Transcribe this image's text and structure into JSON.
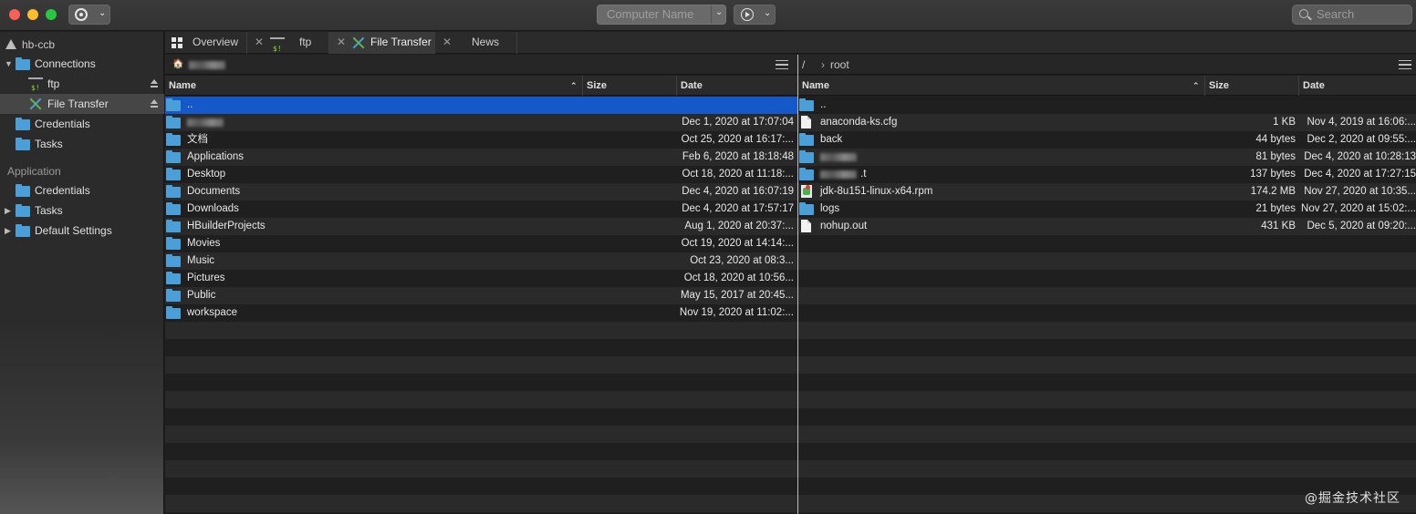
{
  "titlebar": {
    "computer_name_placeholder": "Computer Name",
    "search_placeholder": "Search"
  },
  "sidebar": {
    "account": "hb-ccb",
    "connections_label": "Connections",
    "connections": [
      {
        "label": "ftp",
        "icon": "terminal-icon"
      },
      {
        "label": "File Transfer",
        "icon": "file-transfer-icon"
      }
    ],
    "credentials_label": "Credentials",
    "tasks_label": "Tasks",
    "application_header": "Application",
    "app_credentials_label": "Credentials",
    "app_tasks_label": "Tasks",
    "default_settings_label": "Default Settings"
  },
  "tabs": [
    {
      "label": "Overview",
      "icon": "grid-icon"
    },
    {
      "label": "ftp",
      "icon": "terminal-icon"
    },
    {
      "label": "File Transfer",
      "icon": "file-transfer-icon"
    },
    {
      "label": "News",
      "icon": ""
    }
  ],
  "columns": {
    "name": "Name",
    "size": "Size",
    "date": "Date"
  },
  "left_pane": {
    "path_icon": "home-icon",
    "rows": [
      {
        "name": "..",
        "size": "",
        "date": "",
        "type": "folder",
        "selected": true
      },
      {
        "name": "",
        "size": "",
        "date": "Dec 1, 2020 at 17:07:04",
        "type": "folder",
        "redacted": true
      },
      {
        "name": "文档",
        "size": "",
        "date": "Oct 25, 2020 at 16:17:...",
        "type": "folder"
      },
      {
        "name": "Applications",
        "size": "",
        "date": "Feb 6, 2020 at 18:18:48",
        "type": "folder"
      },
      {
        "name": "Desktop",
        "size": "",
        "date": "Oct 18, 2020 at 11:18:...",
        "type": "folder"
      },
      {
        "name": "Documents",
        "size": "",
        "date": "Dec 4, 2020 at 16:07:19",
        "type": "folder"
      },
      {
        "name": "Downloads",
        "size": "",
        "date": "Dec 4, 2020 at 17:57:17",
        "type": "folder"
      },
      {
        "name": "HBuilderProjects",
        "size": "",
        "date": "Aug 1, 2020 at 20:37:...",
        "type": "folder"
      },
      {
        "name": "Movies",
        "size": "",
        "date": "Oct 19, 2020 at 14:14:...",
        "type": "folder"
      },
      {
        "name": "Music",
        "size": "",
        "date": "Oct 23, 2020 at 08:3...",
        "type": "folder"
      },
      {
        "name": "Pictures",
        "size": "",
        "date": "Oct 18, 2020 at 10:56...",
        "type": "folder"
      },
      {
        "name": "Public",
        "size": "",
        "date": "May 15, 2017 at 20:45...",
        "type": "folder"
      },
      {
        "name": "workspace",
        "size": "",
        "date": "Nov 19, 2020 at 11:02:...",
        "type": "folder"
      }
    ]
  },
  "right_pane": {
    "path_root": "/",
    "path_current": "root",
    "rows": [
      {
        "name": "..",
        "size": "",
        "date": "",
        "type": "folder"
      },
      {
        "name": "anaconda-ks.cfg",
        "size": "1 KB",
        "date": "Nov 4, 2019 at 16:06:...",
        "type": "file"
      },
      {
        "name": "back",
        "size": "44 bytes",
        "date": "Dec 2, 2020 at 09:55:...",
        "type": "folder"
      },
      {
        "name": "",
        "size": "81 bytes",
        "date": "Dec 4, 2020 at 10:28:13",
        "type": "folder",
        "redacted": true
      },
      {
        "name": ".t",
        "size": "137 bytes",
        "date": "Dec 4, 2020 at 17:27:15",
        "type": "folder",
        "redacted": true
      },
      {
        "name": "jdk-8u151-linux-x64.rpm",
        "size": "174.2 MB",
        "date": "Nov 27, 2020 at 10:35...",
        "type": "rpm"
      },
      {
        "name": "logs",
        "size": "21 bytes",
        "date": "Nov 27, 2020 at 15:02:...",
        "type": "folder"
      },
      {
        "name": "nohup.out",
        "size": "431 KB",
        "date": "Dec 5, 2020 at 09:20:...",
        "type": "file"
      }
    ]
  },
  "watermark": "@掘金技术社区",
  "colors": {
    "selection": "#1558c9",
    "folder": "#4a9fd8",
    "close": "#fe5f57",
    "minimize": "#febc2e",
    "maximize": "#28c840"
  }
}
